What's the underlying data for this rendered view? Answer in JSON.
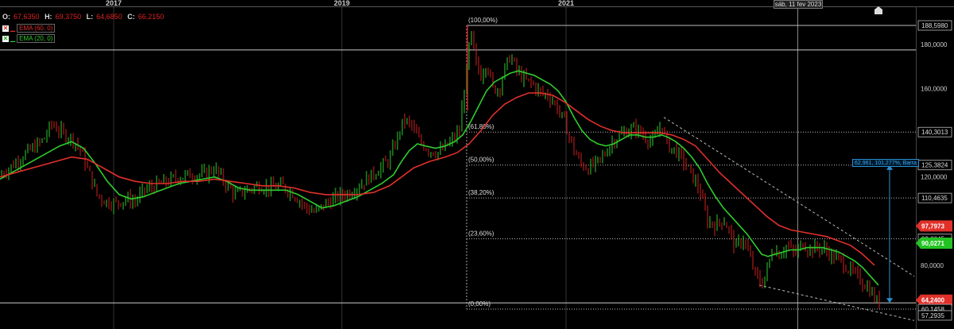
{
  "header": {
    "years": [
      "2017",
      "2019",
      "2021"
    ],
    "crosshair_date": "sáb, 11 fev 2023"
  },
  "ohlc": {
    "o_label": "O:",
    "o_value": "67,6350",
    "h_label": "H:",
    "h_value": "69,3750",
    "l_label": "L:",
    "l_value": "64,6850",
    "c_label": "C:",
    "c_value": "66,2150"
  },
  "indicators": [
    {
      "name": "EMA (60, 0)",
      "color": "#e0302a"
    },
    {
      "name": "EMA (20, 0)",
      "color": "#2ecc2e"
    }
  ],
  "measure_label": "62,961, 101,277%, Barra",
  "price_axis": {
    "ticks": [
      "180,0000",
      "160,0000",
      "120,0000",
      "80,0000"
    ],
    "tags": [
      {
        "text": "188,5980",
        "bg": "#000",
        "fg": "#ddd"
      },
      {
        "text": "140,3013",
        "bg": "#000",
        "fg": "#ddd"
      },
      {
        "text": "125,3824",
        "bg": "#000",
        "fg": "#ddd"
      },
      {
        "text": "110,4635",
        "bg": "#000",
        "fg": "#ddd"
      },
      {
        "text": "97,7973",
        "bg": "#e0302a",
        "fg": "#fff"
      },
      {
        "text": "92,0045",
        "bg": "#000",
        "fg": "#ddd"
      },
      {
        "text": "90,0271",
        "bg": "#22c322",
        "fg": "#fff"
      },
      {
        "text": "64,2400",
        "bg": "#e0302a",
        "fg": "#fff"
      },
      {
        "text": "60,1458",
        "bg": "#000",
        "fg": "#ddd"
      },
      {
        "text": "57,2935",
        "bg": "#000",
        "fg": "#ddd"
      }
    ]
  },
  "chart_data": {
    "type": "line",
    "title": "",
    "x_axis_labels": [
      "2017",
      "2019",
      "2021"
    ],
    "ylim": [
      55,
      195
    ],
    "fibonacci": [
      {
        "label": "(100,00%)",
        "value": 188.598
      },
      {
        "label": "(61,80%)",
        "value": 140.3013
      },
      {
        "label": "(50,00%)",
        "value": 125.3824
      },
      {
        "label": "(38,20%)",
        "value": 110.4635
      },
      {
        "label": "(23,60%)",
        "value": 92.0045
      },
      {
        "label": "(0,00%)",
        "value": 60.1458
      }
    ],
    "horizontal_lines": [
      177.5,
      63.0
    ],
    "price_path": [
      [
        0,
        121
      ],
      [
        15,
        125
      ],
      [
        30,
        130
      ],
      [
        45,
        134
      ],
      [
        55,
        137
      ],
      [
        65,
        144
      ],
      [
        78,
        140
      ],
      [
        92,
        137
      ],
      [
        100,
        133
      ],
      [
        112,
        122
      ],
      [
        122,
        112
      ],
      [
        132,
        109
      ],
      [
        145,
        108
      ],
      [
        158,
        110
      ],
      [
        170,
        109
      ],
      [
        182,
        114
      ],
      [
        195,
        116
      ],
      [
        210,
        118
      ],
      [
        225,
        120
      ],
      [
        240,
        121
      ],
      [
        255,
        121
      ],
      [
        270,
        124
      ],
      [
        282,
        118
      ],
      [
        295,
        112
      ],
      [
        310,
        114
      ],
      [
        325,
        116
      ],
      [
        340,
        115
      ],
      [
        355,
        116
      ],
      [
        370,
        112
      ],
      [
        385,
        106
      ],
      [
        397,
        104
      ],
      [
        410,
        108
      ],
      [
        425,
        111
      ],
      [
        440,
        113
      ],
      [
        455,
        117
      ],
      [
        468,
        121
      ],
      [
        478,
        124
      ],
      [
        490,
        128
      ],
      [
        500,
        138
      ],
      [
        508,
        146
      ],
      [
        518,
        143
      ],
      [
        528,
        136
      ],
      [
        540,
        132
      ],
      [
        552,
        131
      ],
      [
        562,
        134
      ],
      [
        572,
        138
      ],
      [
        578,
        141
      ],
      [
        582,
        154
      ],
      [
        587,
        168
      ],
      [
        592,
        186
      ],
      [
        598,
        172
      ],
      [
        605,
        166
      ],
      [
        612,
        172
      ],
      [
        620,
        160
      ],
      [
        628,
        160
      ],
      [
        635,
        169
      ],
      [
        642,
        175
      ],
      [
        650,
        168
      ],
      [
        660,
        164
      ],
      [
        670,
        162
      ],
      [
        680,
        158
      ],
      [
        690,
        157
      ],
      [
        700,
        152
      ],
      [
        710,
        145
      ],
      [
        720,
        134
      ],
      [
        730,
        126
      ],
      [
        740,
        124
      ],
      [
        750,
        126
      ],
      [
        760,
        130
      ],
      [
        770,
        136
      ],
      [
        780,
        139
      ],
      [
        790,
        141
      ],
      [
        800,
        142
      ],
      [
        812,
        138
      ],
      [
        822,
        136
      ],
      [
        832,
        144
      ],
      [
        840,
        134
      ],
      [
        850,
        132
      ],
      [
        860,
        127
      ],
      [
        870,
        121
      ],
      [
        880,
        114
      ],
      [
        890,
        100
      ],
      [
        900,
        98
      ],
      [
        910,
        101
      ],
      [
        918,
        95
      ],
      [
        925,
        88
      ],
      [
        935,
        92
      ],
      [
        942,
        85
      ],
      [
        950,
        76
      ],
      [
        958,
        71
      ],
      [
        965,
        78
      ],
      [
        972,
        88
      ],
      [
        980,
        85
      ],
      [
        990,
        89
      ],
      [
        1000,
        85
      ],
      [
        1010,
        90
      ],
      [
        1018,
        87
      ],
      [
        1028,
        88
      ],
      [
        1038,
        87
      ],
      [
        1048,
        84
      ],
      [
        1058,
        82
      ],
      [
        1068,
        78
      ],
      [
        1078,
        75
      ],
      [
        1086,
        72
      ],
      [
        1094,
        69
      ],
      [
        1102,
        64
      ],
      [
        1108,
        63
      ]
    ],
    "series": [
      {
        "name": "EMA (20, 0)",
        "color": "#2ecc2e",
        "points": [
          [
            0,
            119
          ],
          [
            20,
            123
          ],
          [
            40,
            127
          ],
          [
            60,
            131
          ],
          [
            75,
            134
          ],
          [
            90,
            136
          ],
          [
            105,
            133
          ],
          [
            120,
            126
          ],
          [
            135,
            118
          ],
          [
            150,
            112
          ],
          [
            165,
            110
          ],
          [
            180,
            111
          ],
          [
            195,
            113
          ],
          [
            210,
            115
          ],
          [
            225,
            117
          ],
          [
            240,
            118
          ],
          [
            255,
            119
          ],
          [
            270,
            120
          ],
          [
            285,
            118
          ],
          [
            300,
            115
          ],
          [
            315,
            114
          ],
          [
            330,
            114
          ],
          [
            345,
            114
          ],
          [
            360,
            114
          ],
          [
            375,
            112
          ],
          [
            390,
            109
          ],
          [
            405,
            106
          ],
          [
            420,
            107
          ],
          [
            435,
            109
          ],
          [
            450,
            111
          ],
          [
            465,
            114
          ],
          [
            480,
            117
          ],
          [
            495,
            121
          ],
          [
            505,
            127
          ],
          [
            515,
            132
          ],
          [
            525,
            135
          ],
          [
            535,
            134
          ],
          [
            548,
            133
          ],
          [
            560,
            134
          ],
          [
            572,
            136
          ],
          [
            582,
            139
          ],
          [
            592,
            145
          ],
          [
            602,
            152
          ],
          [
            612,
            159
          ],
          [
            622,
            163
          ],
          [
            632,
            165
          ],
          [
            642,
            167
          ],
          [
            652,
            168
          ],
          [
            662,
            167
          ],
          [
            672,
            166
          ],
          [
            682,
            164
          ],
          [
            692,
            162
          ],
          [
            702,
            159
          ],
          [
            712,
            154
          ],
          [
            722,
            147
          ],
          [
            732,
            141
          ],
          [
            742,
            137
          ],
          [
            752,
            135
          ],
          [
            762,
            134
          ],
          [
            772,
            135
          ],
          [
            782,
            137
          ],
          [
            792,
            139
          ],
          [
            802,
            139
          ],
          [
            812,
            138
          ],
          [
            822,
            138
          ],
          [
            832,
            139
          ],
          [
            840,
            138
          ],
          [
            850,
            136
          ],
          [
            860,
            133
          ],
          [
            870,
            129
          ],
          [
            880,
            124
          ],
          [
            890,
            117
          ],
          [
            900,
            111
          ],
          [
            910,
            106
          ],
          [
            920,
            102
          ],
          [
            930,
            98
          ],
          [
            940,
            94
          ],
          [
            950,
            89
          ],
          [
            958,
            85
          ],
          [
            966,
            84
          ],
          [
            975,
            85
          ],
          [
            985,
            86
          ],
          [
            995,
            87
          ],
          [
            1005,
            87
          ],
          [
            1015,
            88
          ],
          [
            1025,
            88
          ],
          [
            1035,
            88
          ],
          [
            1045,
            87
          ],
          [
            1055,
            86
          ],
          [
            1065,
            84
          ],
          [
            1075,
            82
          ],
          [
            1085,
            79
          ],
          [
            1095,
            75
          ],
          [
            1105,
            71
          ]
        ]
      },
      {
        "name": "EMA (60, 0)",
        "color": "#e0302a",
        "points": [
          [
            0,
            120
          ],
          [
            30,
            123
          ],
          [
            60,
            126
          ],
          [
            90,
            129
          ],
          [
            110,
            128
          ],
          [
            130,
            124
          ],
          [
            150,
            120
          ],
          [
            170,
            118
          ],
          [
            190,
            117
          ],
          [
            210,
            117
          ],
          [
            230,
            118
          ],
          [
            250,
            118
          ],
          [
            270,
            119
          ],
          [
            290,
            118
          ],
          [
            310,
            117
          ],
          [
            330,
            116
          ],
          [
            350,
            116
          ],
          [
            370,
            115
          ],
          [
            390,
            113
          ],
          [
            410,
            112
          ],
          [
            430,
            112
          ],
          [
            450,
            112
          ],
          [
            470,
            113
          ],
          [
            490,
            116
          ],
          [
            505,
            120
          ],
          [
            520,
            124
          ],
          [
            540,
            127
          ],
          [
            560,
            129
          ],
          [
            575,
            131
          ],
          [
            590,
            135
          ],
          [
            605,
            141
          ],
          [
            620,
            148
          ],
          [
            635,
            153
          ],
          [
            650,
            156
          ],
          [
            665,
            158
          ],
          [
            680,
            158
          ],
          [
            695,
            157
          ],
          [
            710,
            154
          ],
          [
            725,
            150
          ],
          [
            740,
            146
          ],
          [
            755,
            143
          ],
          [
            770,
            141
          ],
          [
            785,
            140
          ],
          [
            800,
            140
          ],
          [
            815,
            140
          ],
          [
            830,
            140
          ],
          [
            845,
            139
          ],
          [
            860,
            137
          ],
          [
            875,
            134
          ],
          [
            890,
            128
          ],
          [
            905,
            122
          ],
          [
            920,
            117
          ],
          [
            935,
            112
          ],
          [
            950,
            107
          ],
          [
            965,
            102
          ],
          [
            980,
            98
          ],
          [
            995,
            96
          ],
          [
            1010,
            95
          ],
          [
            1025,
            94
          ],
          [
            1040,
            93
          ],
          [
            1055,
            91
          ],
          [
            1070,
            89
          ],
          [
            1085,
            85
          ],
          [
            1100,
            80
          ]
        ]
      }
    ],
    "trendlines": [
      [
        [
          835,
          147
        ],
        [
          1150,
          75
        ]
      ],
      [
        [
          955,
          71
        ],
        [
          1150,
          55
        ]
      ]
    ],
    "measure": {
      "from": 125.3824,
      "to": 63.0,
      "label": "62,961, 101,277%, Barra"
    }
  }
}
